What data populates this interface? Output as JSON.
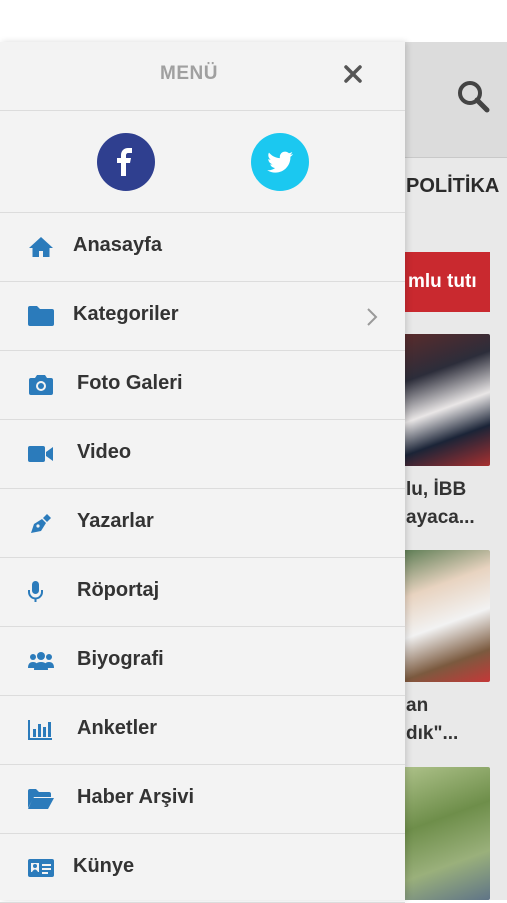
{
  "background": {
    "category_tab": "POLİTİKA",
    "breaking_text": "mlu tutı",
    "headline_1_line_1": "lu, İBB",
    "headline_1_line_2": "ayaca...",
    "headline_2_line_1": "an",
    "headline_2_line_2": "dık\"..."
  },
  "drawer": {
    "title": "MENÜ",
    "menu": [
      {
        "label": "Anasayfa",
        "icon": "home-icon"
      },
      {
        "label": "Kategoriler",
        "icon": "folder-icon",
        "has_submenu": true
      },
      {
        "label": "Foto Galeri",
        "icon": "camera-icon"
      },
      {
        "label": "Video",
        "icon": "video-icon"
      },
      {
        "label": "Yazarlar",
        "icon": "pen-icon"
      },
      {
        "label": "Röportaj",
        "icon": "microphone-icon"
      },
      {
        "label": "Biyografi",
        "icon": "users-icon"
      },
      {
        "label": "Anketler",
        "icon": "chart-icon"
      },
      {
        "label": "Haber Arşivi",
        "icon": "folder-open-icon"
      },
      {
        "label": "Künye",
        "icon": "id-card-icon"
      }
    ]
  },
  "colors": {
    "accent_blue": "#2b7bbb",
    "facebook": "#2f3f8f",
    "twitter": "#1bc8f0",
    "breaking_red": "#c9292f"
  }
}
